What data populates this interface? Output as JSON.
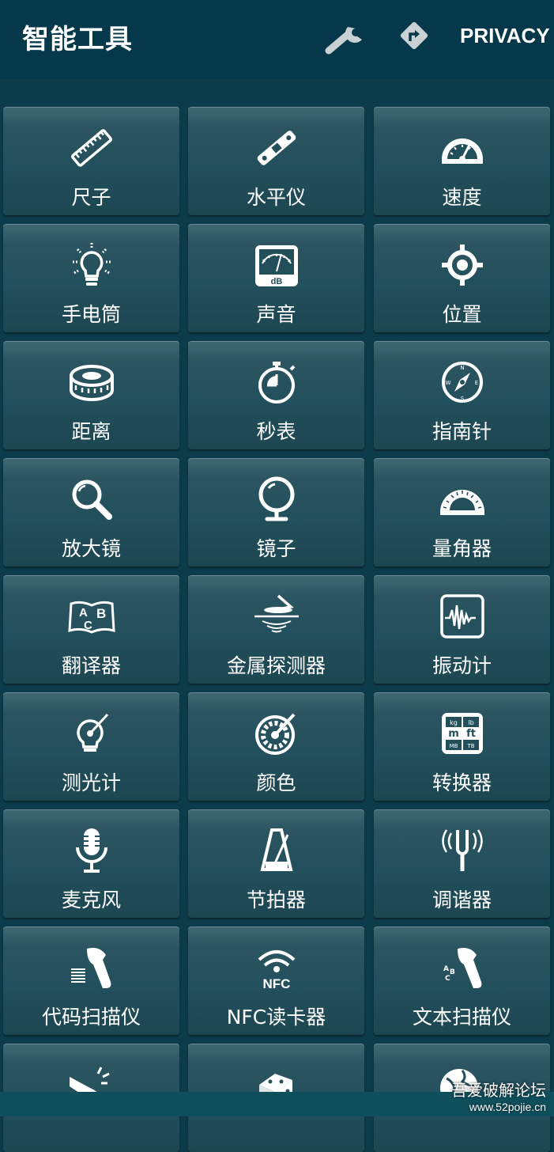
{
  "app": {
    "title": "智能工具",
    "privacy": "PRIVACY",
    "icons": [
      "wrench-icon",
      "direction-sign-icon"
    ]
  },
  "tools": [
    {
      "label": "尺子",
      "icon": "ruler"
    },
    {
      "label": "水平仪",
      "icon": "level"
    },
    {
      "label": "速度",
      "icon": "speedometer"
    },
    {
      "label": "手电筒",
      "icon": "bulb"
    },
    {
      "label": "声音",
      "icon": "db-meter"
    },
    {
      "label": "位置",
      "icon": "target"
    },
    {
      "label": "距离",
      "icon": "tape"
    },
    {
      "label": "秒表",
      "icon": "stopwatch"
    },
    {
      "label": "指南针",
      "icon": "compass"
    },
    {
      "label": "放大镜",
      "icon": "magnifier"
    },
    {
      "label": "镜子",
      "icon": "mirror"
    },
    {
      "label": "量角器",
      "icon": "protractor"
    },
    {
      "label": "翻译器",
      "icon": "book-abc"
    },
    {
      "label": "金属探测器",
      "icon": "metal-detector"
    },
    {
      "label": "振动计",
      "icon": "vibration"
    },
    {
      "label": "测光计",
      "icon": "light-meter"
    },
    {
      "label": "颜色",
      "icon": "color-dial"
    },
    {
      "label": "转换器",
      "icon": "converter"
    },
    {
      "label": "麦克风",
      "icon": "microphone"
    },
    {
      "label": "节拍器",
      "icon": "metronome"
    },
    {
      "label": "调谐器",
      "icon": "tuning-fork"
    },
    {
      "label": "代码扫描仪",
      "icon": "barcode-scanner"
    },
    {
      "label": "NFC读卡器",
      "icon": "nfc"
    },
    {
      "label": "文本扫描仪",
      "icon": "text-scanner"
    },
    {
      "label": "",
      "icon": "hand-tap"
    },
    {
      "label": "",
      "icon": "dice"
    },
    {
      "label": "",
      "icon": "globe"
    }
  ],
  "watermark": {
    "line1": "吾爱破解论坛",
    "line2": "www.52pojie.cn"
  }
}
